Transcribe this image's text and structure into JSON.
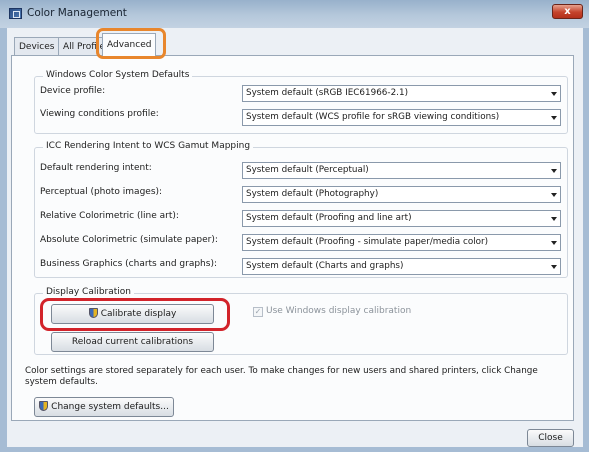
{
  "window": {
    "title": "Color Management",
    "close_label": "x"
  },
  "tabs": [
    {
      "label": "Devices",
      "active": false
    },
    {
      "label": "All Profiles",
      "active": false
    },
    {
      "label": "Advanced",
      "active": true
    }
  ],
  "wcs_defaults": {
    "title": "Windows Color System Defaults",
    "rows": [
      {
        "label": "Device profile:",
        "value": "System default (sRGB IEC61966-2.1)"
      },
      {
        "label": "Viewing conditions profile:",
        "value": "System default (WCS profile for sRGB viewing conditions)"
      }
    ]
  },
  "icc_mapping": {
    "title": "ICC Rendering Intent to WCS Gamut Mapping",
    "rows": [
      {
        "label": "Default rendering intent:",
        "value": "System default (Perceptual)"
      },
      {
        "label": "Perceptual (photo images):",
        "value": "System default (Photography)"
      },
      {
        "label": "Relative Colorimetric (line art):",
        "value": "System default (Proofing and line art)"
      },
      {
        "label": "Absolute Colorimetric (simulate paper):",
        "value": "System default (Proofing - simulate paper/media color)"
      },
      {
        "label": "Business Graphics (charts and graphs):",
        "value": "System default (Charts and graphs)"
      }
    ]
  },
  "display_calibration": {
    "title": "Display Calibration",
    "calibrate_label": "Calibrate display",
    "reload_label": "Reload current calibrations",
    "use_windows_label": "Use Windows display calibration",
    "use_windows_checked": true,
    "use_windows_enabled": false
  },
  "footer": {
    "info": "Color settings are stored separately for each user. To make changes for new users and shared printers, click Change system defaults.",
    "change_defaults_label": "Change system defaults...",
    "close_label": "Close"
  },
  "colors": {
    "tab_highlight": "#e8862c",
    "button_highlight": "#d2232a"
  }
}
